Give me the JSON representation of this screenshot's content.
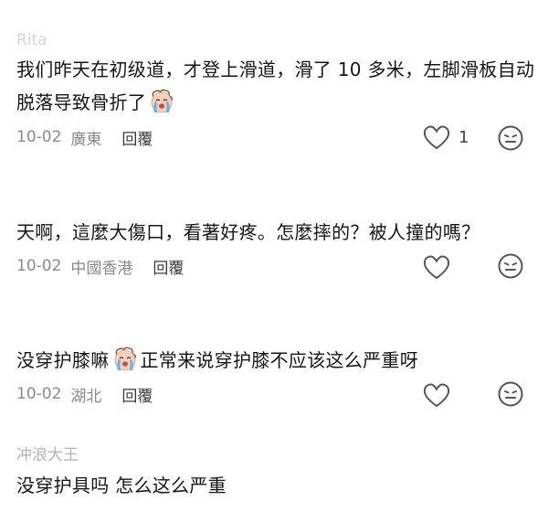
{
  "comments": [
    {
      "username": "Rita",
      "text_before": "我们昨天在初级道，才登上滑道，滑了 10 多米，左脚滑板自动脱落导致骨折了",
      "text_after": "",
      "emoji": "crying-face",
      "date": "10-02",
      "location": "廣東",
      "reply_label": "回覆",
      "likes": "1"
    },
    {
      "username": "",
      "text_before": "天啊，這麼大傷口，看著好疼。怎麼摔的？被人撞的嗎？",
      "text_after": "",
      "emoji": "",
      "date": "10-02",
      "location": "中國香港",
      "reply_label": "回覆",
      "likes": ""
    },
    {
      "username": "",
      "text_before": "没穿护膝嘛",
      "text_after": "正常来说穿护膝不应该这么严重呀",
      "emoji": "crying-face",
      "date": "10-02",
      "location": "湖北",
      "reply_label": "回覆",
      "likes": ""
    },
    {
      "username": "冲浪大王",
      "text_before": "没穿护具吗 怎么这么严重",
      "text_after": "",
      "emoji": ""
    }
  ],
  "icons": {
    "like": "heart-outline-icon",
    "react": "emoji-face-icon",
    "inline": "crying-face"
  },
  "colors": {
    "text": "#161616",
    "meta": "#8a8a8a",
    "username": "#b3b3b3",
    "icon": "#555555"
  }
}
